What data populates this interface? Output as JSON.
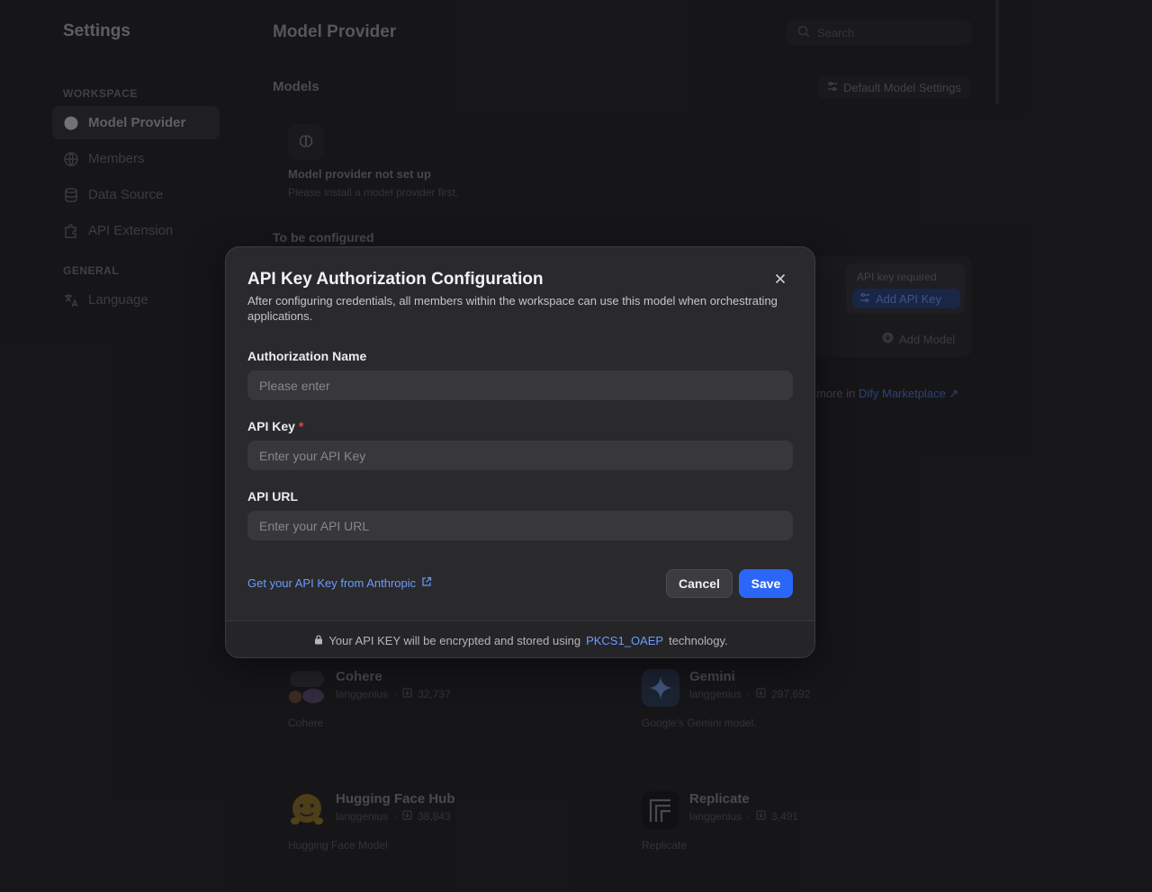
{
  "sidebar": {
    "title": "Settings",
    "workspace_label": "WORKSPACE",
    "general_label": "GENERAL",
    "items": [
      {
        "label": "Model Provider",
        "icon": "brain-icon"
      },
      {
        "label": "Members",
        "icon": "globe-icon"
      },
      {
        "label": "Data Source",
        "icon": "database-icon"
      },
      {
        "label": "API Extension",
        "icon": "puzzle-icon"
      },
      {
        "label": "Language",
        "icon": "translate-icon"
      }
    ]
  },
  "header": {
    "title": "Model Provider",
    "search_placeholder": "Search"
  },
  "models": {
    "title": "Models",
    "default_settings_label": "Default Model Settings",
    "empty_title": "Model provider not set up",
    "empty_desc": "Please install a model provider first."
  },
  "to_configure": {
    "title": "To be configured",
    "api_key_required": "API key required",
    "add_api_key": "Add API Key",
    "add_model": "Add Model",
    "marketplace_prefix": "more in",
    "marketplace_link": "Dify Marketplace ↗"
  },
  "plugins": [
    {
      "name": "Cohere",
      "author": "langgenius",
      "installs": "32,737",
      "desc": "Cohere"
    },
    {
      "name": "Gemini",
      "author": "langgenius",
      "installs": "297,692",
      "desc": "Google's Gemini model."
    },
    {
      "name": "Hugging Face Hub",
      "author": "langgenius",
      "installs": "38,843",
      "desc": "Hugging Face Model"
    },
    {
      "name": "Replicate",
      "author": "langgenius",
      "installs": "3,491",
      "desc": "Replicate"
    }
  ],
  "modal": {
    "title": "API Key Authorization Configuration",
    "description": "After configuring credentials, all members within the workspace can use this model when orchestrating applications.",
    "fields": {
      "auth_name_label": "Authorization Name",
      "auth_name_placeholder": "Please enter",
      "api_key_label": "API Key",
      "api_key_required_mark": "*",
      "api_key_placeholder": "Enter your API Key",
      "api_url_label": "API URL",
      "api_url_placeholder": "Enter your API URL"
    },
    "help_link": "Get your API Key from Anthropic",
    "cancel_label": "Cancel",
    "save_label": "Save",
    "footer_prefix": "Your API KEY will be encrypted and stored using",
    "footer_tech": "PKCS1_OAEP",
    "footer_suffix": "technology."
  },
  "colors": {
    "accent": "#2b67f6",
    "link": "#6b9bff",
    "required": "#e5484d"
  }
}
